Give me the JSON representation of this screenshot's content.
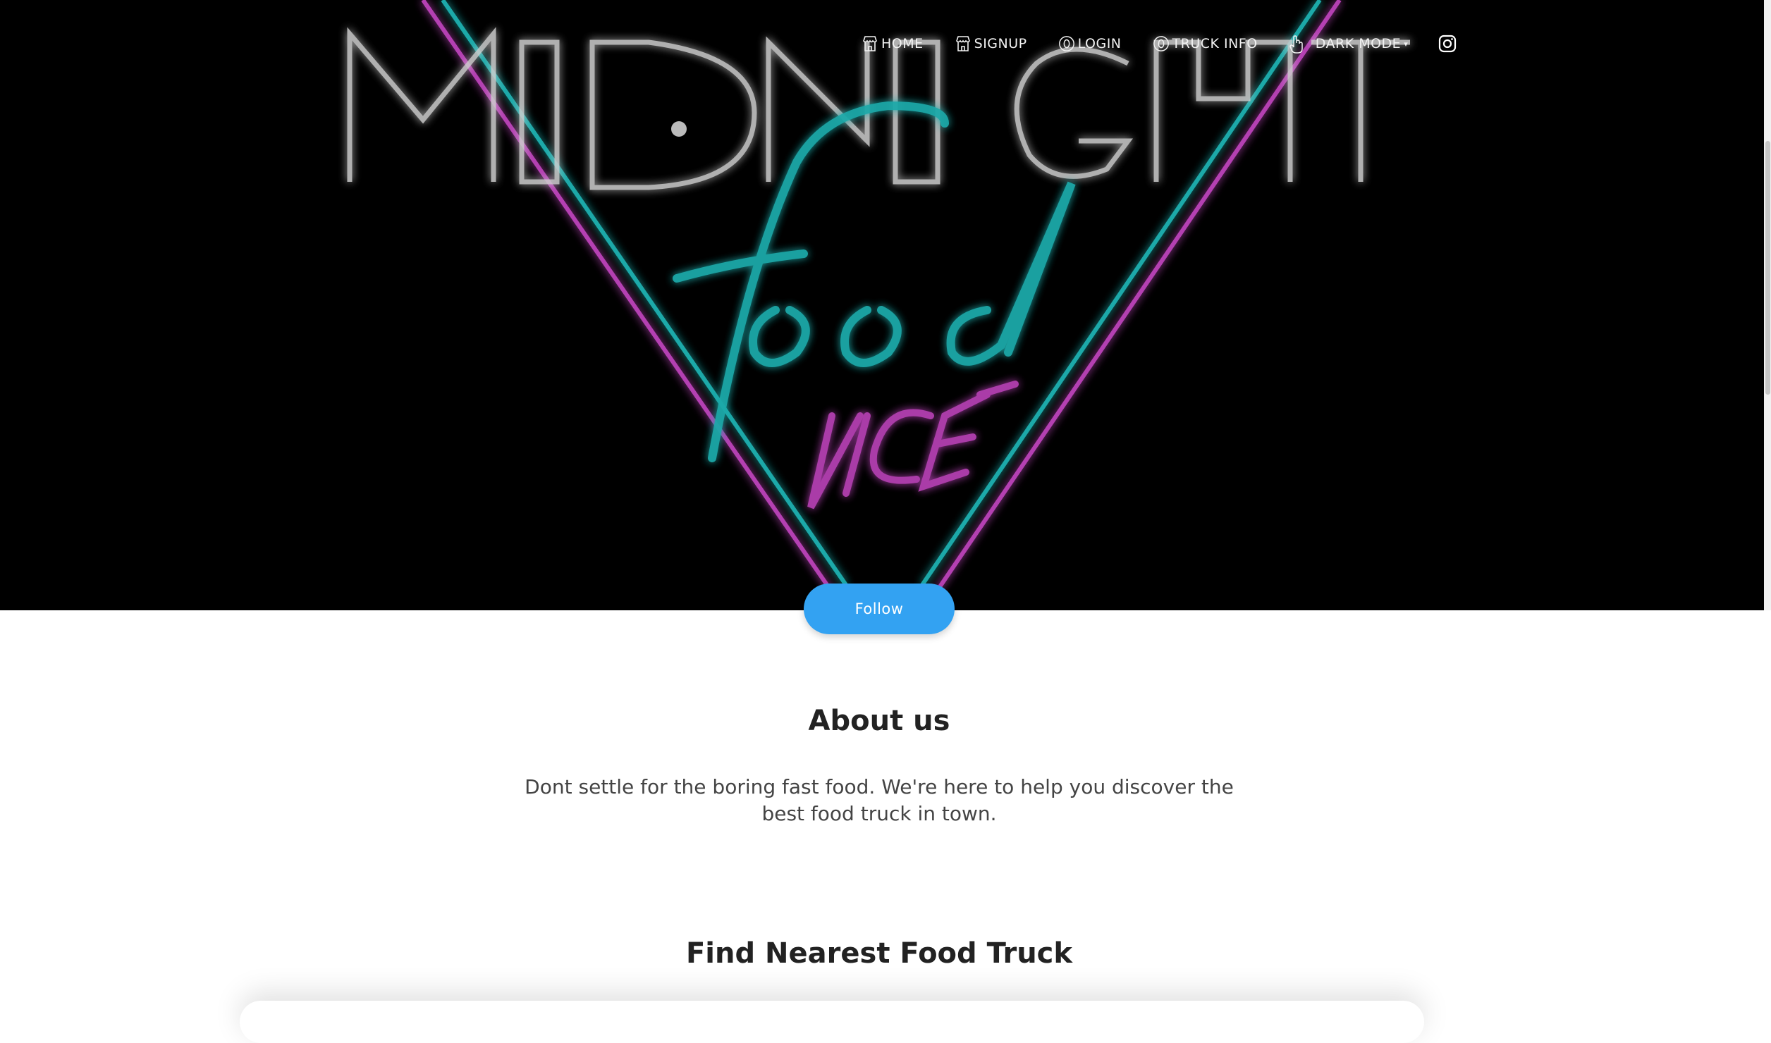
{
  "nav": {
    "items": [
      {
        "label": "HOME",
        "icon": "store-icon"
      },
      {
        "label": "SIGNUP",
        "icon": "store-icon"
      },
      {
        "label": "LOGIN",
        "icon": "user-circle-icon"
      },
      {
        "label": "TRUCK INFO",
        "icon": "user-circle-icon"
      },
      {
        "label": "DARK MODE",
        "icon": "pointer-hand-icon"
      }
    ],
    "social_icon": "instagram-icon"
  },
  "hero": {
    "logo_words": [
      "MIDNIGHT",
      "Food",
      "VICE"
    ],
    "colors": {
      "background": "#000000",
      "teal": "#1fa9a9",
      "magenta": "#b43fb2",
      "white_neon": "#cfcfcf"
    }
  },
  "follow_button": {
    "label": "Follow",
    "color": "#33a2f2"
  },
  "about": {
    "title": "About us",
    "text": "Dont settle for the boring fast food. We're here to help you discover the best food truck in town."
  },
  "find": {
    "title": "Find Nearest Food Truck"
  }
}
